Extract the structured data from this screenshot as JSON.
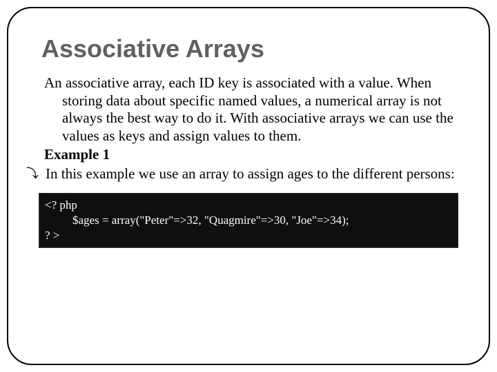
{
  "title": "Associative Arrays",
  "paragraph": "An associative array, each ID key is associated with a value. When storing data about specific named values, a numerical array is not always the best way to do it. With associative arrays we can use the values as keys and assign values to them.",
  "example_label": "Example 1",
  "bullet_glyph": "⤵",
  "example_intro": "In this example we use an array to assign ages to the different persons:",
  "code": {
    "open": "<? php",
    "body": "$ages = array(\"Peter\"=>32, \"Quagmire\"=>30, \"Joe\"=>34);",
    "close": "? >"
  }
}
